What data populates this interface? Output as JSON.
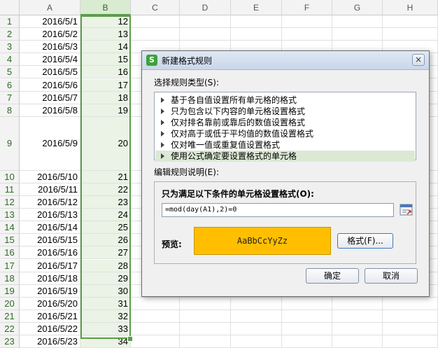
{
  "sheet": {
    "columns": [
      "",
      "A",
      "B",
      "C",
      "D",
      "E",
      "F",
      "G",
      "H"
    ],
    "selected_column": "B",
    "rows": [
      {
        "n": "1",
        "a": "2016/5/1",
        "b": "12"
      },
      {
        "n": "2",
        "a": "2016/5/2",
        "b": "13"
      },
      {
        "n": "3",
        "a": "2016/5/3",
        "b": "14"
      },
      {
        "n": "4",
        "a": "2016/5/4",
        "b": "15"
      },
      {
        "n": "5",
        "a": "2016/5/5",
        "b": "16"
      },
      {
        "n": "6",
        "a": "2016/5/6",
        "b": "17"
      },
      {
        "n": "7",
        "a": "2016/5/7",
        "b": "18"
      },
      {
        "n": "8",
        "a": "2016/5/8",
        "b": "19"
      },
      {
        "n": "9",
        "a": "2016/5/9",
        "b": "20"
      },
      {
        "n": "10",
        "a": "2016/5/10",
        "b": "21"
      },
      {
        "n": "11",
        "a": "2016/5/11",
        "b": "22"
      },
      {
        "n": "12",
        "a": "2016/5/12",
        "b": "23"
      },
      {
        "n": "13",
        "a": "2016/5/13",
        "b": "24"
      },
      {
        "n": "14",
        "a": "2016/5/14",
        "b": "25"
      },
      {
        "n": "15",
        "a": "2016/5/15",
        "b": "26"
      },
      {
        "n": "16",
        "a": "2016/5/16",
        "b": "27"
      },
      {
        "n": "17",
        "a": "2016/5/17",
        "b": "28"
      },
      {
        "n": "18",
        "a": "2016/5/18",
        "b": "29"
      },
      {
        "n": "19",
        "a": "2016/5/19",
        "b": "30"
      },
      {
        "n": "20",
        "a": "2016/5/20",
        "b": "31"
      },
      {
        "n": "21",
        "a": "2016/5/21",
        "b": "32"
      },
      {
        "n": "22",
        "a": "2016/5/22",
        "b": "33"
      },
      {
        "n": "23",
        "a": "2016/5/23",
        "b": "34"
      }
    ]
  },
  "dialog": {
    "title": "新建格式规则",
    "close_label": "×",
    "app_icon": "S",
    "select_rule_type_label": "选择规则类型(S):",
    "rule_types": [
      "基于各自值设置所有单元格的格式",
      "只为包含以下内容的单元格设置格式",
      "仅对排名靠前或靠后的数值设置格式",
      "仅对高于或低于平均值的数值设置格式",
      "仅对唯一值或重复值设置格式",
      "使用公式确定要设置格式的单元格"
    ],
    "selected_rule_index": 5,
    "edit_desc_label": "编辑规则说明(E):",
    "condition_title": "只为满足以下条件的单元格设置格式(O):",
    "formula": "=mod(day(A1),2)=0",
    "preview_label": "预览:",
    "preview_text": "AaBbCcYyZz",
    "format_button": "格式(F)...",
    "ok_button": "确定",
    "cancel_button": "取消"
  },
  "colors": {
    "selection_green": "#5c9e4a",
    "preview_fill": "#ffbf00"
  }
}
